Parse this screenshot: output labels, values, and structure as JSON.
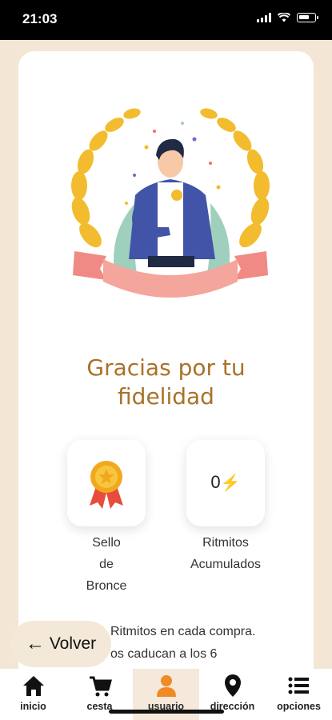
{
  "status_bar": {
    "time": "21:03"
  },
  "title": "Gracias por tu fidelidad",
  "badges": {
    "seal_label_lines": [
      "Sello",
      "de",
      "Bronce"
    ],
    "points_value": "0",
    "points_label_lines": [
      "Ritmitos",
      "Acumulados"
    ]
  },
  "info_lines": [
    "Ritmitos en cada compra.",
    "os caducan a los 6"
  ],
  "back_button": {
    "label": "Volver",
    "icon": "arrow-left-icon"
  },
  "nav": [
    {
      "label": "inicio",
      "icon": "home-icon"
    },
    {
      "label": "cesta",
      "icon": "cart-icon"
    },
    {
      "label": "usuario",
      "icon": "user-icon",
      "active": true
    },
    {
      "label": "dirección",
      "icon": "location-pin-icon"
    },
    {
      "label": "opciones",
      "icon": "list-icon"
    }
  ],
  "colors": {
    "accent": "#a8722a",
    "active_nav": "#f08a24",
    "background": "#f3e6d4"
  }
}
